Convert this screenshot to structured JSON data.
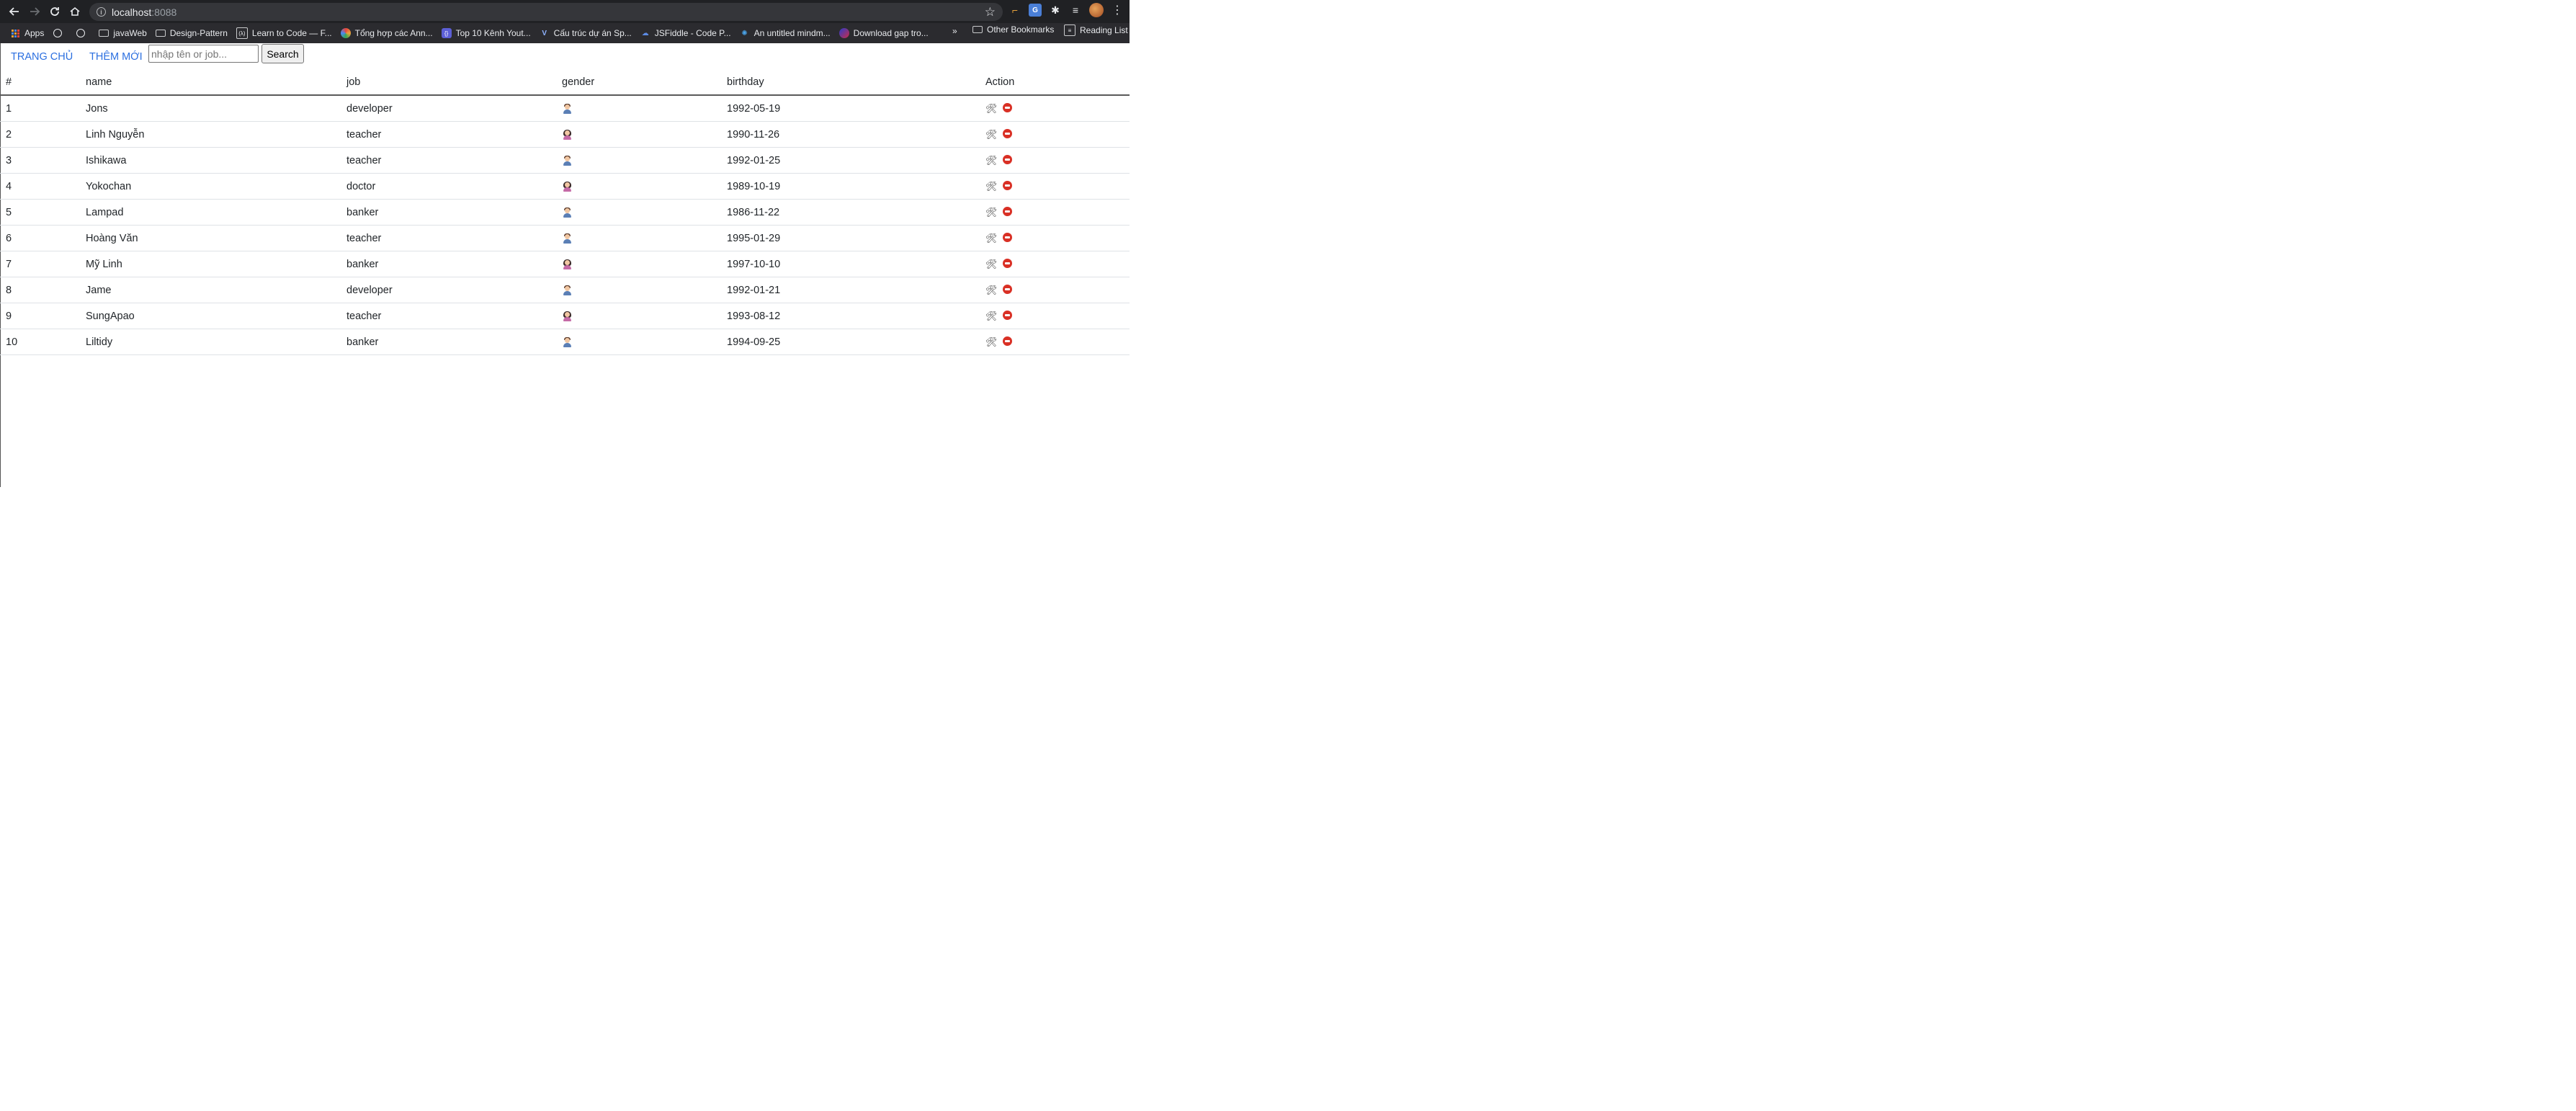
{
  "browser": {
    "url_host": "localhost",
    "url_port": ":8088",
    "bookmarks": [
      {
        "label": "Apps",
        "icon": "apps-grid-icon"
      },
      {
        "label": "",
        "icon": "globe-icon"
      },
      {
        "label": "",
        "icon": "globe-icon"
      },
      {
        "label": "javaWeb",
        "icon": "folder-icon"
      },
      {
        "label": "Design-Pattern",
        "icon": "folder-icon"
      },
      {
        "label": "Learn to Code — F...",
        "icon": "freecodecamp-icon"
      },
      {
        "label": "Tổng hợp các Ann...",
        "icon": "colorwheel-icon"
      },
      {
        "label": "Top 10 Kênh Yout...",
        "icon": "code-icon"
      },
      {
        "label": "Cấu trúc dự án Sp...",
        "icon": "vuetify-icon"
      },
      {
        "label": "JSFiddle - Code P...",
        "icon": "jsfiddle-icon"
      },
      {
        "label": "An untitled mindm...",
        "icon": "mindmap-icon"
      },
      {
        "label": "Download gap tro...",
        "icon": "download-icon"
      }
    ],
    "overflow_label": "»",
    "other_bookmarks": "Other Bookmarks",
    "reading_list": "Reading List"
  },
  "nav": {
    "home": "TRANG CHỦ",
    "add_new": "THÊM MỚI",
    "search_placeholder": "nhập tên or job...",
    "search_button": "Search"
  },
  "table": {
    "headers": [
      "#",
      "name",
      "job",
      "gender",
      "birthday",
      "Action"
    ],
    "rows": [
      {
        "id": "1",
        "name": "Jons",
        "job": "developer",
        "gender": "male",
        "birthday": "1992-05-19"
      },
      {
        "id": "2",
        "name": "Linh Nguyễn",
        "job": "teacher",
        "gender": "female",
        "birthday": "1990-11-26"
      },
      {
        "id": "3",
        "name": "Ishikawa",
        "job": "teacher",
        "gender": "male",
        "birthday": "1992-01-25"
      },
      {
        "id": "4",
        "name": "Yokochan",
        "job": "doctor",
        "gender": "female",
        "birthday": "1989-10-19"
      },
      {
        "id": "5",
        "name": "Lampad",
        "job": "banker",
        "gender": "male",
        "birthday": "1986-11-22"
      },
      {
        "id": "6",
        "name": "Hoàng Văn",
        "job": "teacher",
        "gender": "male",
        "birthday": "1995-01-29"
      },
      {
        "id": "7",
        "name": "Mỹ Linh",
        "job": "banker",
        "gender": "female",
        "birthday": "1997-10-10"
      },
      {
        "id": "8",
        "name": "Jame",
        "job": "developer",
        "gender": "male",
        "birthday": "1992-01-21"
      },
      {
        "id": "9",
        "name": "SungApao",
        "job": "teacher",
        "gender": "female",
        "birthday": "1993-08-12"
      },
      {
        "id": "10",
        "name": "Liltidy",
        "job": "banker",
        "gender": "male",
        "birthday": "1994-09-25"
      }
    ],
    "action_icons": [
      "edit-tools-icon",
      "delete-no-entry-icon"
    ]
  },
  "colors": {
    "link": "#2b6fe0",
    "chrome_bg": "#202124",
    "bookmarks_bg": "#2b2b2f",
    "delete": "#d93025"
  }
}
